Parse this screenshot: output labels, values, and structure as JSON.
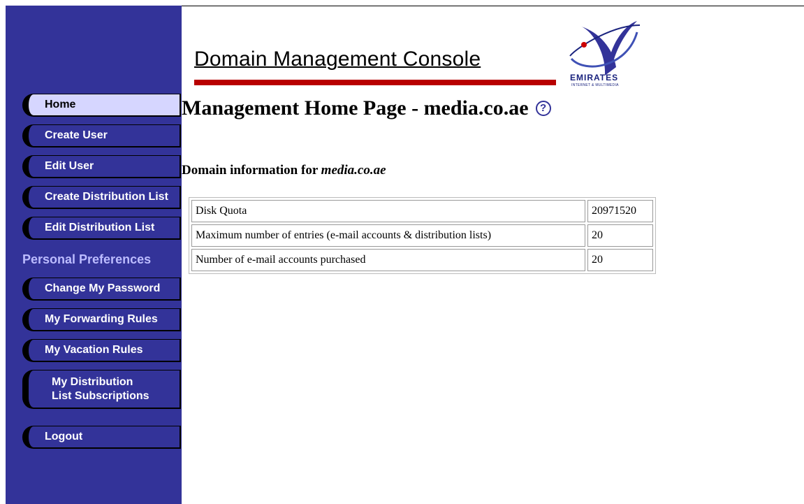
{
  "header": {
    "console_title": "Domain Management Console",
    "logo_text": "EMIRATES",
    "logo_subtext": "INTERNET & MULTIMEDIA",
    "brand_color": "#333399",
    "accent_color": "#b80000"
  },
  "sidebar": {
    "items": [
      {
        "label": "Home",
        "active": true
      },
      {
        "label": "Create User"
      },
      {
        "label": "Edit User"
      },
      {
        "label": "Create Distribution List"
      },
      {
        "label": "Edit Distribution List"
      }
    ],
    "personal_heading": "Personal Preferences",
    "personal_items": [
      {
        "label": "Change My Password"
      },
      {
        "label": "My Forwarding Rules"
      },
      {
        "label": "My Vacation Rules"
      },
      {
        "label_line1": "My Distribution",
        "label_line2": "List Subscriptions"
      }
    ],
    "logout_label": "Logout"
  },
  "main": {
    "page_title": "Management Home Page - media.co.ae",
    "help_icon_glyph": "?",
    "section_prefix": "Domain information for ",
    "section_domain": "media.co.ae",
    "table": [
      {
        "label": "Disk Quota",
        "value": "20971520"
      },
      {
        "label": "Maximum number of entries (e-mail accounts & distribution lists)",
        "value": "20"
      },
      {
        "label": "Number of e-mail accounts purchased",
        "value": "20"
      }
    ]
  }
}
